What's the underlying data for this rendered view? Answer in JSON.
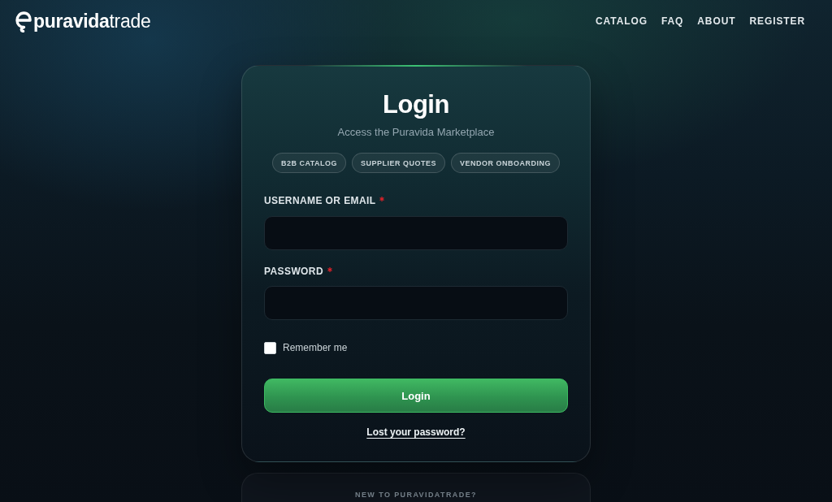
{
  "header": {
    "wordmark": "**puravida**trade",
    "nav": [
      "CATALOG",
      "FAQ",
      "ABOUT",
      "REGISTER"
    ]
  },
  "login_card": {
    "title": "Login",
    "subtitle": "Access the Puravida Marketplace",
    "tags": [
      "B2B CATALOG",
      "SUPPLIER QUOTES",
      "VENDOR ONBOARDING"
    ],
    "fields": [
      {
        "label": "USERNAME OR EMAIL",
        "required": true
      },
      {
        "label": "PASSWORD",
        "required": true
      }
    ],
    "remember": {
      "label": "Remember me",
      "checked": false
    },
    "submit": "Login",
    "lost_password": "Lost your password?"
  },
  "register_card": {
    "prompt": "NEW TO PURAVIDATRADE?"
  }
}
